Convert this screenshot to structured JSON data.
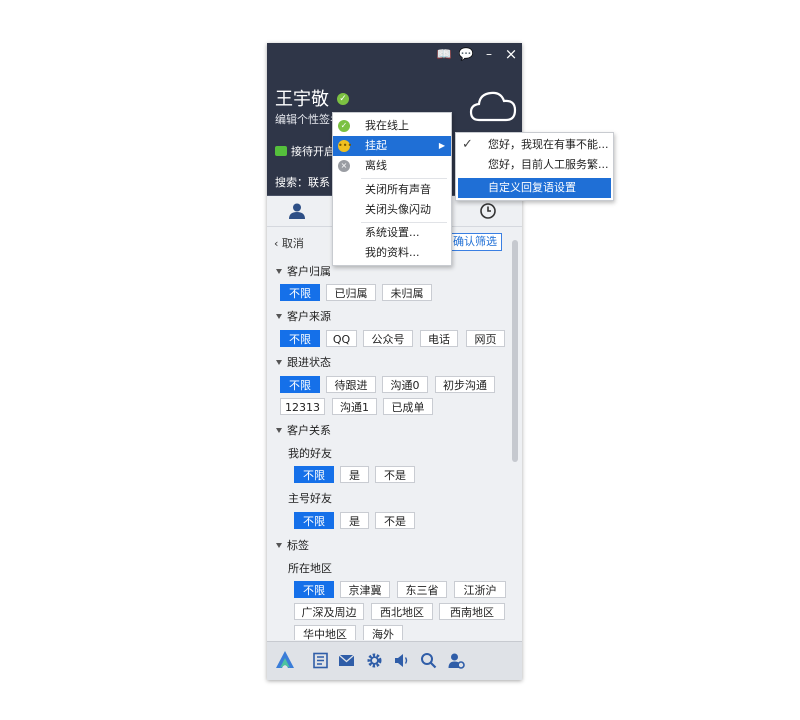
{
  "window": {
    "controls": [
      "📖",
      "💬",
      "–",
      "×"
    ]
  },
  "profile": {
    "name": "王宇敬",
    "signature": "编辑个性签名",
    "reception": "接待开启",
    "search_label": "搜索：联系"
  },
  "filter": {
    "cancel": "取消",
    "confirm": "确认筛选",
    "sections": [
      {
        "title": "客户归属",
        "options": [
          "不限",
          "已归属",
          "未归属"
        ]
      },
      {
        "title": "客户来源",
        "options": [
          "不限",
          "QQ",
          "公众号",
          "电话",
          "网页"
        ]
      },
      {
        "title": "跟进状态",
        "options": [
          "不限",
          "待跟进",
          "沟通0",
          "初步沟通",
          "12313",
          "沟通1",
          "已成单"
        ]
      },
      {
        "title": "客户关系",
        "subs": [
          {
            "title": "我的好友",
            "options": [
              "不限",
              "是",
              "不是"
            ]
          },
          {
            "title": "主号好友",
            "options": [
              "不限",
              "是",
              "不是"
            ]
          }
        ]
      },
      {
        "title": "标签",
        "subs": [
          {
            "title": "所在地区",
            "options": [
              "不限",
              "京津冀",
              "东三省",
              "江浙沪",
              "广深及周边",
              "西北地区",
              "西南地区",
              "华中地区",
              "海外"
            ]
          }
        ]
      }
    ]
  },
  "status_menu": {
    "items": [
      "我在线上",
      "挂起",
      "离线",
      "关闭所有声音",
      "关闭头像闪动",
      "系统设置...",
      "我的资料..."
    ],
    "highlighted": "挂起",
    "submenu_arrow": "▶"
  },
  "reply_submenu": {
    "items": [
      "您好，我现在有事不能...",
      "您好，目前人工服务繁...",
      "自定义回复语设置"
    ],
    "checked": "您好，我现在有事不能...",
    "highlighted": "自定义回复语设置",
    "check_mark": "✓"
  },
  "colors": {
    "header_bg": "#2f3648",
    "accent": "#1570e9",
    "online": "#7cc142",
    "away": "#f0c020"
  }
}
